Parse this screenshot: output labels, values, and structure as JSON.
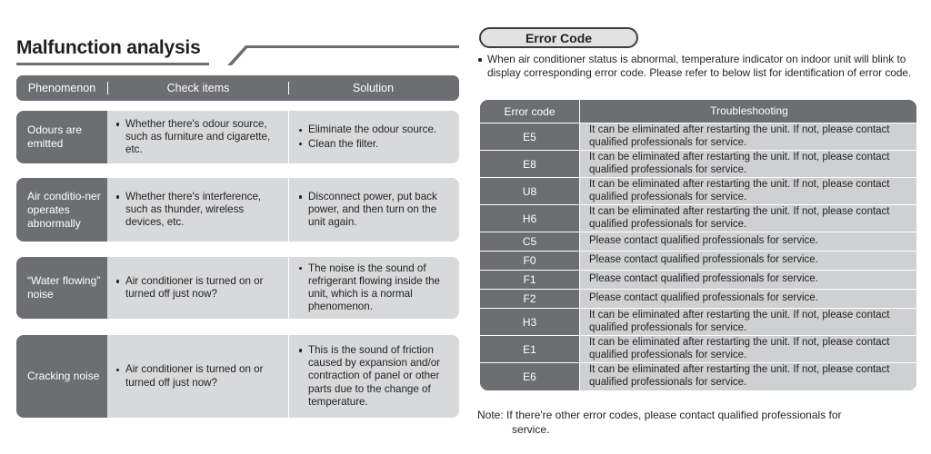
{
  "left": {
    "title": "Malfunction analysis",
    "table": {
      "headers": [
        "Phenomenon",
        "Check items",
        "Solution"
      ],
      "rows": [
        {
          "phenomenon": "Odours are emitted",
          "check_items": [
            "Whether there's odour source, such as furniture and cigarette, etc."
          ],
          "solution": [
            "Eliminate the odour source.",
            "Clean the filter."
          ]
        },
        {
          "phenomenon": "Air conditio-ner operates abnormally",
          "check_items": [
            "Whether there's interference, such as thunder, wireless devices, etc."
          ],
          "solution": [
            "Disconnect power, put back power, and then turn on the unit again."
          ]
        },
        {
          "phenomenon": "“Water flowing” noise",
          "check_items": [
            "Air conditioner is turned on or turned off just now?"
          ],
          "solution": [
            "The noise is the sound of refrigerant flowing inside the unit, which is a normal phenomenon."
          ]
        },
        {
          "phenomenon": "Cracking noise",
          "check_items": [
            "Air conditioner is turned on or turned off just now?"
          ],
          "solution": [
            "This is the sound of friction caused by expansion and/or contraction of panel or other parts due to the change of temperature."
          ]
        }
      ]
    }
  },
  "right": {
    "pill_label": "Error Code",
    "intro": "When air conditioner status is abnormal, temperature indicator on indoor unit will blink to display corresponding error code. Please refer to below list for identification of error code.",
    "table": {
      "headers": [
        "Error code",
        "Troubleshooting"
      ],
      "rows": [
        {
          "code": "E5",
          "text": "It can be eliminated after restarting the unit. If not, please contact qualified professionals for service.",
          "tall": true
        },
        {
          "code": "E8",
          "text": "It can be eliminated after restarting the unit. If not, please contact qualified professionals for service.",
          "tall": true
        },
        {
          "code": "U8",
          "text": "It can be eliminated after restarting the unit. If not, please contact qualified professionals for service.",
          "tall": true
        },
        {
          "code": "H6",
          "text": "It can be eliminated after restarting the unit. If not, please contact qualified professionals for service.",
          "tall": true
        },
        {
          "code": "C5",
          "text": "Please contact qualified professionals for service.",
          "tall": false
        },
        {
          "code": "F0",
          "text": "Please contact qualified professionals for service.",
          "tall": false
        },
        {
          "code": "F1",
          "text": "Please contact qualified professionals for service.",
          "tall": false
        },
        {
          "code": "F2",
          "text": "Please contact qualified professionals for service.",
          "tall": false
        },
        {
          "code": "H3",
          "text": "It can be eliminated after restarting the unit. If not, please contact qualified professionals for service.",
          "tall": true
        },
        {
          "code": "E1",
          "text": "It can be eliminated after restarting the unit. If not, please contact qualified professionals for service.",
          "tall": true
        },
        {
          "code": "E6",
          "text": "It can be eliminated after restarting the unit. If not, please contact qualified professionals for service.",
          "tall": true
        }
      ]
    },
    "note_label": "Note:",
    "note_text": "If there're other error codes, please contact qualified professionals for",
    "note_text_2": "service."
  },
  "colors": {
    "header_gray": "#6d6e71",
    "cell_gray": "#d8d9da",
    "error_cell_gray": "#cfd0d1",
    "pill_fill": "#e2e2e2",
    "text": "#231f20"
  }
}
